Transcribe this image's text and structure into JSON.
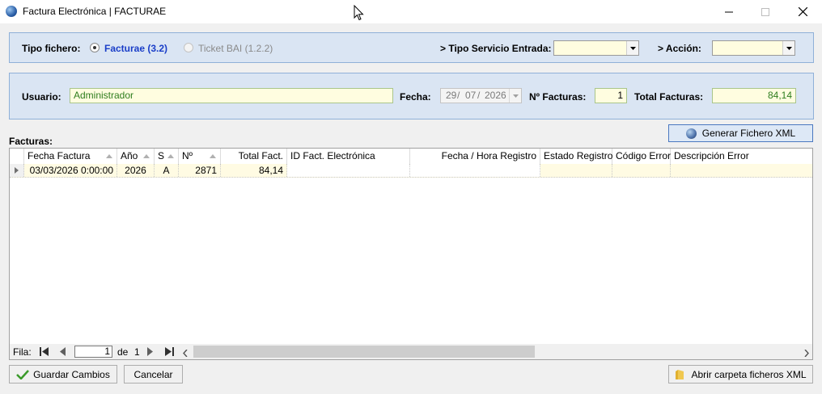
{
  "window": {
    "title": "Factura Electrónica  |  FACTURAE"
  },
  "top_panel": {
    "tipo_fichero_label": "Tipo fichero:",
    "radio_facturae": "Facturae (3.2)",
    "radio_ticketbai": "Ticket BAI (1.2.2)",
    "tipo_servicio_label": "> Tipo Servicio Entrada:",
    "tipo_servicio_value": "",
    "accion_label": "> Acción:",
    "accion_value": ""
  },
  "user_panel": {
    "usuario_label": "Usuario:",
    "usuario_value": "Administrador",
    "fecha_label": "Fecha:",
    "fecha_day": "29",
    "fecha_month": "07",
    "fecha_year": "2026",
    "num_facturas_label": "Nº Facturas:",
    "num_facturas_value": "1",
    "total_label": "Total Facturas:",
    "total_value": "84,14"
  },
  "invoices": {
    "section_label": "Facturas:",
    "generate_button": "Generar Fichero XML",
    "columns": [
      "Fecha Factura",
      "Año",
      "S",
      "Nº",
      "Total Fact.",
      "ID Fact. Electrónica",
      "Fecha / Hora Registro",
      "Estado Registro",
      "Código Error",
      "Descripción Error"
    ],
    "rows": [
      [
        "03/03/2026 0:00:00",
        "2026",
        "A",
        "2871",
        "84,14",
        "",
        "",
        "",
        "",
        ""
      ]
    ]
  },
  "pager": {
    "fila_label": "Fila:",
    "current": "1",
    "de_label": "de",
    "total": "1"
  },
  "footer": {
    "save_button": "Guardar Cambios",
    "cancel_button": "Cancelar",
    "open_folder_button": "Abrir carpeta ficheros XML"
  },
  "colors": {
    "panel_bg": "#dae5f3",
    "field_bg": "#fffde0",
    "row_bg": "#fffbe3",
    "radio_active": "#1a3ec8"
  }
}
